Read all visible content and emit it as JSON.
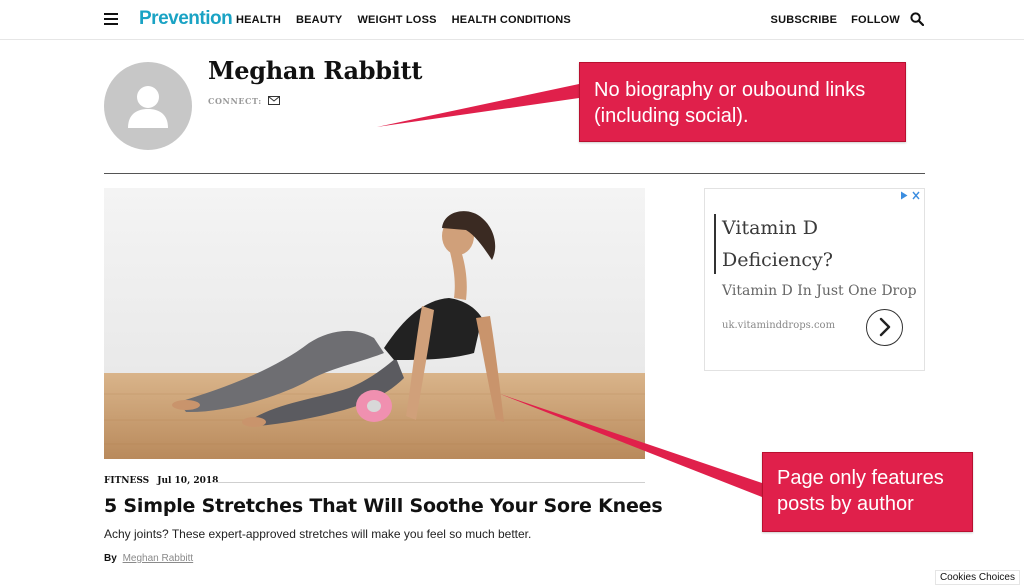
{
  "nav": {
    "logo": "Prevention",
    "links": [
      "HEALTH",
      "BEAUTY",
      "WEIGHT LOSS",
      "HEALTH CONDITIONS"
    ],
    "subscribe": "SUBSCRIBE",
    "follow": "FOLLOW"
  },
  "author": {
    "name": "Meghan Rabbitt",
    "connect_label": "CONNECT:"
  },
  "annotations": {
    "callout1": "No biography or oubound links (including social).",
    "callout2": "Page only features posts by author"
  },
  "article": {
    "category": "FITNESS",
    "date": "Jul 10, 2018",
    "title": "5 Simple Stretches That Will Soothe Your Sore Knees",
    "dek": "Achy joints? These expert-approved stretches will make you feel so much better.",
    "byline_prefix": "By",
    "byline_author": "Meghan Rabbitt"
  },
  "ad": {
    "headline": "Vitamin D Deficiency?",
    "subheadline": "Vitamin D In Just One Drop",
    "url": "uk.vitaminddrops.com"
  },
  "cookies": "Cookies Choices",
  "colors": {
    "brand": "#1aa3c4",
    "callout": "#e0204b",
    "adchoices": "#3b8de0"
  }
}
